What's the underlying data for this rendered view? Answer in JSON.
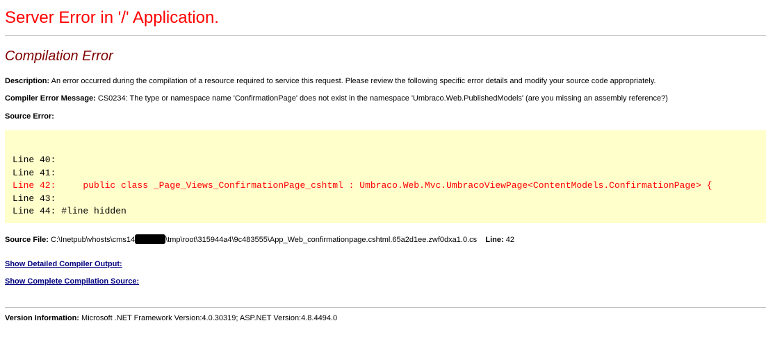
{
  "header": {
    "title": "Server Error in '/' Application."
  },
  "error": {
    "heading": "Compilation Error",
    "description_label": "Description:",
    "description_text": " An error occurred during the compilation of a resource required to service this request. Please review the following specific error details and modify your source code appropriately.",
    "compiler_message_label": "Compiler Error Message:",
    "compiler_message_text": " CS0234: The type or namespace name 'ConfirmationPage' does not exist in the namespace 'Umbraco.Web.PublishedModels' (are you missing an assembly reference?)",
    "source_error_label": "Source Error:"
  },
  "source_code": {
    "lines": [
      "Line 40:",
      "Line 41:",
      "Line 42:     public class _Page_Views_ConfirmationPage_cshtml : Umbraco.Web.Mvc.UmbracoViewPage<ContentModels.ConfirmationPage> {",
      "Line 43:",
      "Line 44: #line hidden"
    ],
    "highlighted_line": "Line 42"
  },
  "source_file": {
    "label": "Source File:",
    "path_before": " C:\\Inetpub\\vhosts\\cms14",
    "path_after": "\\tmp\\root\\315944a4\\9c483555\\App_Web_confirmationpage.cshtml.65a2d1ee.zwf0dxa1.0.cs",
    "line_label": "Line:",
    "line_value": " 42"
  },
  "links": {
    "detailed_compiler_output": "Show Detailed Compiler Output:",
    "complete_compilation_source": "Show Complete Compilation Source:"
  },
  "version": {
    "label": "Version Information:",
    "text": " Microsoft .NET Framework Version:4.0.30319; ASP.NET Version:4.8.4494.0"
  },
  "colors": {
    "title": "#ff0000",
    "heading": "#800000",
    "code_background": "#ffffcc",
    "code_highlight": "#ff0000",
    "link": "#000080"
  }
}
